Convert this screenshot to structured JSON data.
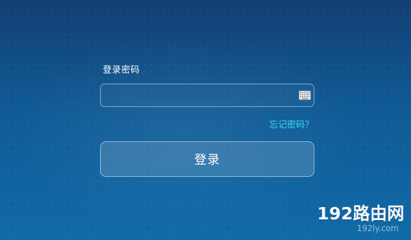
{
  "login": {
    "password_label": "登录密码",
    "password_value": "",
    "keyboard_icon": "keyboard-icon",
    "forgot_password": "忘记密码？",
    "login_button": "登录"
  },
  "watermark": {
    "main": "192路由网",
    "sub": "192ly.com"
  }
}
